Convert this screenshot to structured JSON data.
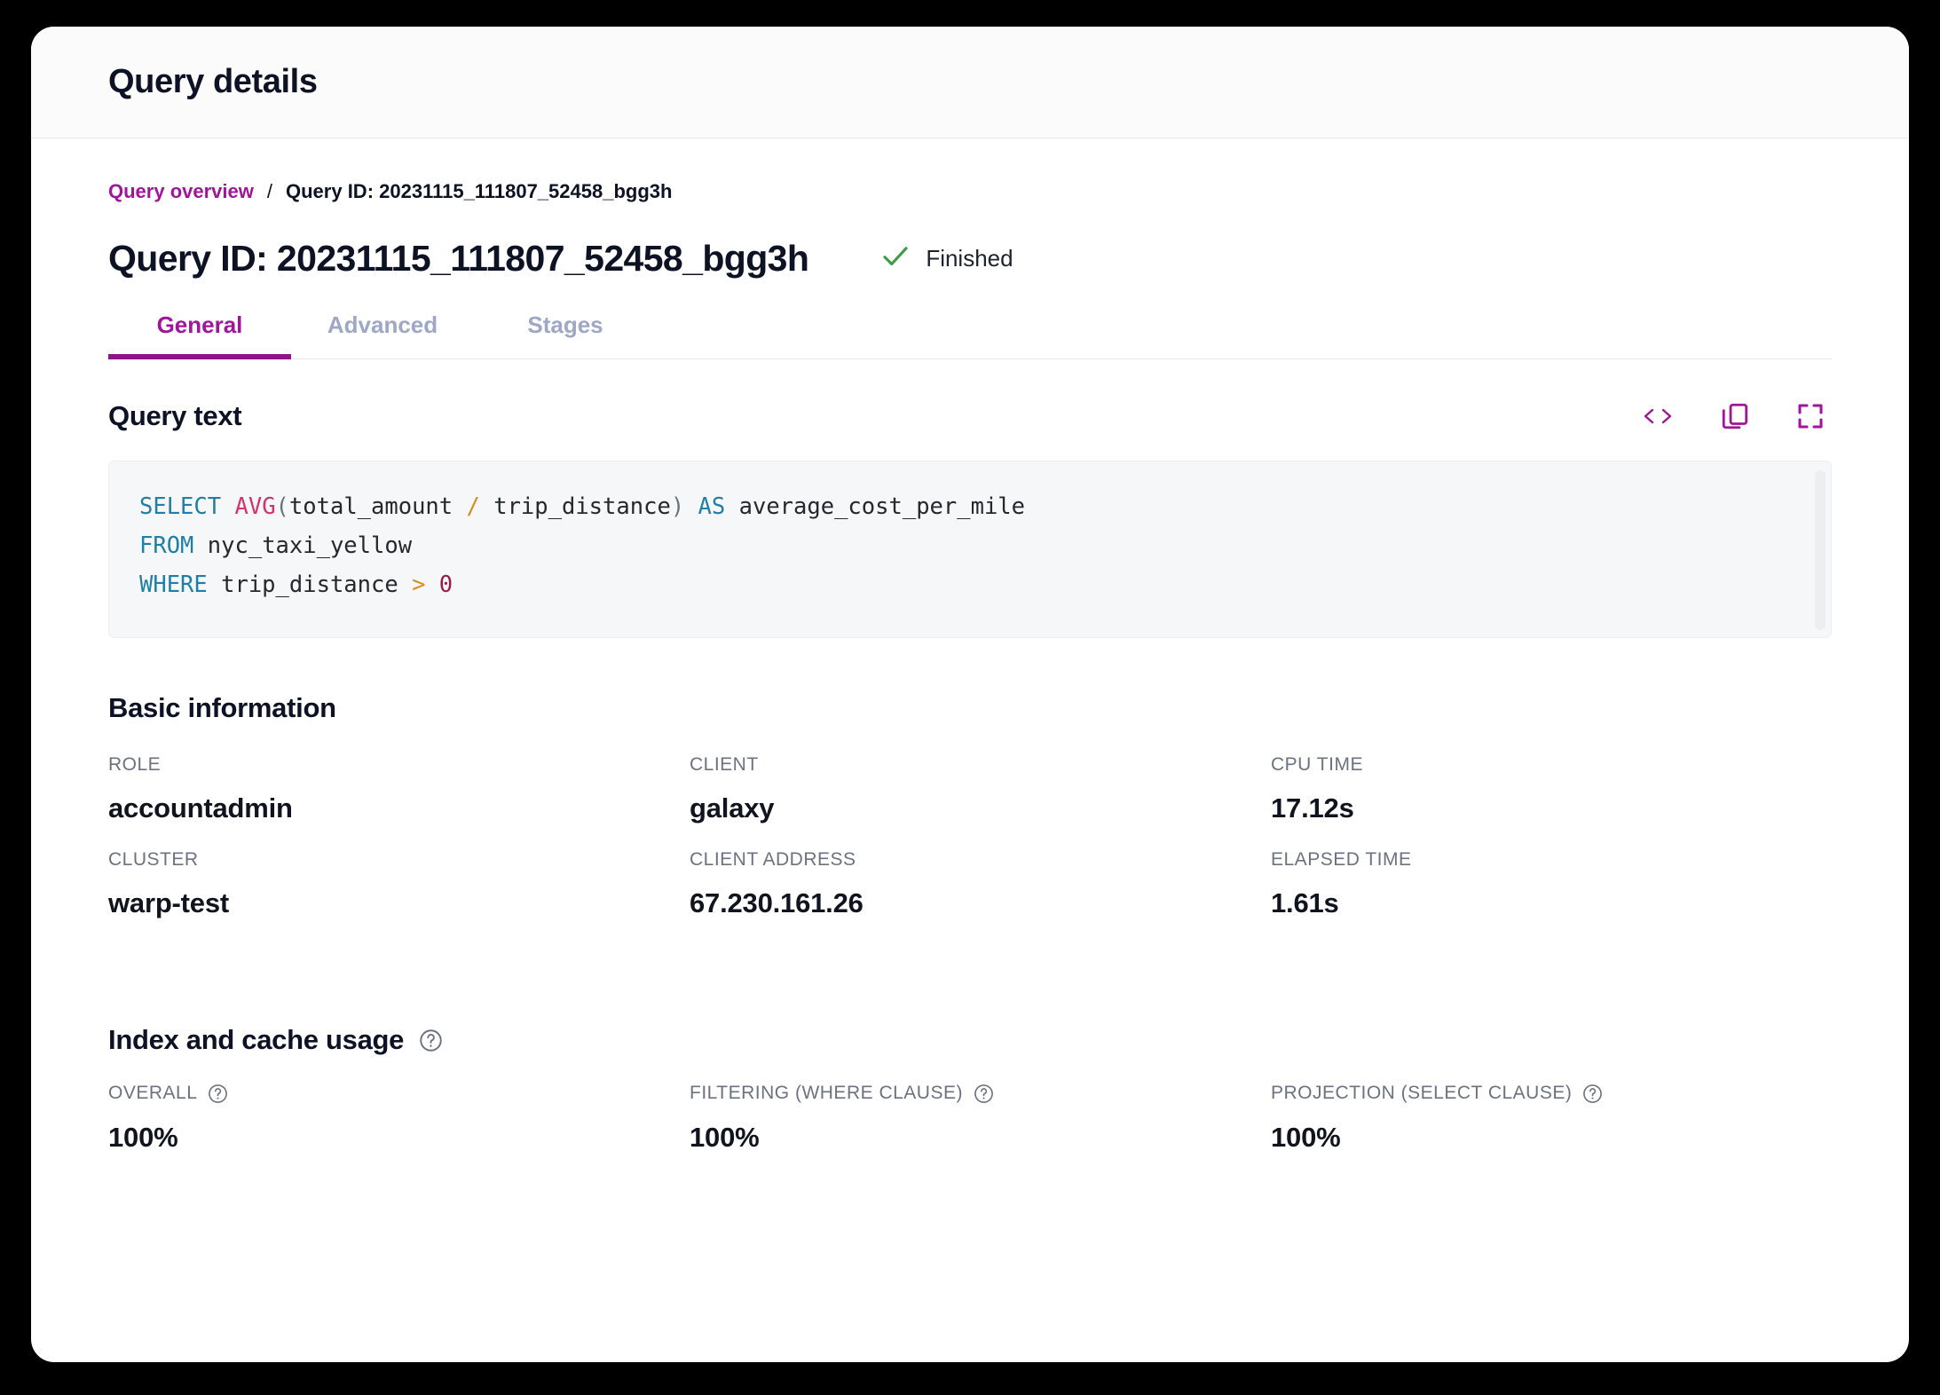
{
  "window": {
    "title": "Query details"
  },
  "breadcrumb": {
    "link": "Query overview",
    "separator": "/",
    "current": "Query ID: 20231115_111807_52458_bgg3h"
  },
  "page": {
    "title": "Query ID: 20231115_111807_52458_bgg3h",
    "status": "Finished",
    "status_icon": "check-icon",
    "status_color": "#3d9c46"
  },
  "tabs": [
    {
      "label": "General",
      "active": true
    },
    {
      "label": "Advanced",
      "active": false
    },
    {
      "label": "Stages",
      "active": false
    }
  ],
  "query_text": {
    "title": "Query text",
    "actions": [
      {
        "icon": "code-brackets-icon"
      },
      {
        "icon": "copy-icon"
      },
      {
        "icon": "fullscreen-icon"
      }
    ],
    "code": {
      "line1": {
        "kw1": "SELECT",
        "fn": "AVG",
        "p1": "(",
        "arg1": "total_amount",
        "op": "/",
        "arg2": "trip_distance",
        "p2": ")",
        "kw2": "AS",
        "alias": "average_cost_per_mile"
      },
      "line2": {
        "kw": "FROM",
        "table": "nyc_taxi_yellow"
      },
      "line3": {
        "kw": "WHERE",
        "col": "trip_distance",
        "op": ">",
        "num": "0"
      }
    }
  },
  "basic_information": {
    "title": "Basic information",
    "fields": [
      {
        "label": "ROLE",
        "value": "accountadmin"
      },
      {
        "label": "CLIENT",
        "value": "galaxy"
      },
      {
        "label": "CPU TIME",
        "value": "17.12s"
      },
      {
        "label": "CLUSTER",
        "value": "warp-test"
      },
      {
        "label": "CLIENT ADDRESS",
        "value": "67.230.161.26"
      },
      {
        "label": "ELAPSED TIME",
        "value": "1.61s"
      }
    ]
  },
  "index_cache_usage": {
    "title": "Index and cache usage",
    "help_icon": "help-circle-icon",
    "fields": [
      {
        "label": "OVERALL",
        "value": "100%",
        "help_icon": "help-circle-icon"
      },
      {
        "label": "FILTERING (WHERE CLAUSE)",
        "value": "100%",
        "help_icon": "help-circle-icon"
      },
      {
        "label": "PROJECTION (SELECT CLAUSE)",
        "value": "100%",
        "help_icon": "help-circle-icon"
      }
    ]
  },
  "colors": {
    "accent": "#a0169a",
    "accent_underline": "#8e1589",
    "success": "#3d9c46",
    "text_dark": "#0d1324",
    "text_muted": "#6b7280",
    "tab_inactive": "#9ea7c6"
  }
}
